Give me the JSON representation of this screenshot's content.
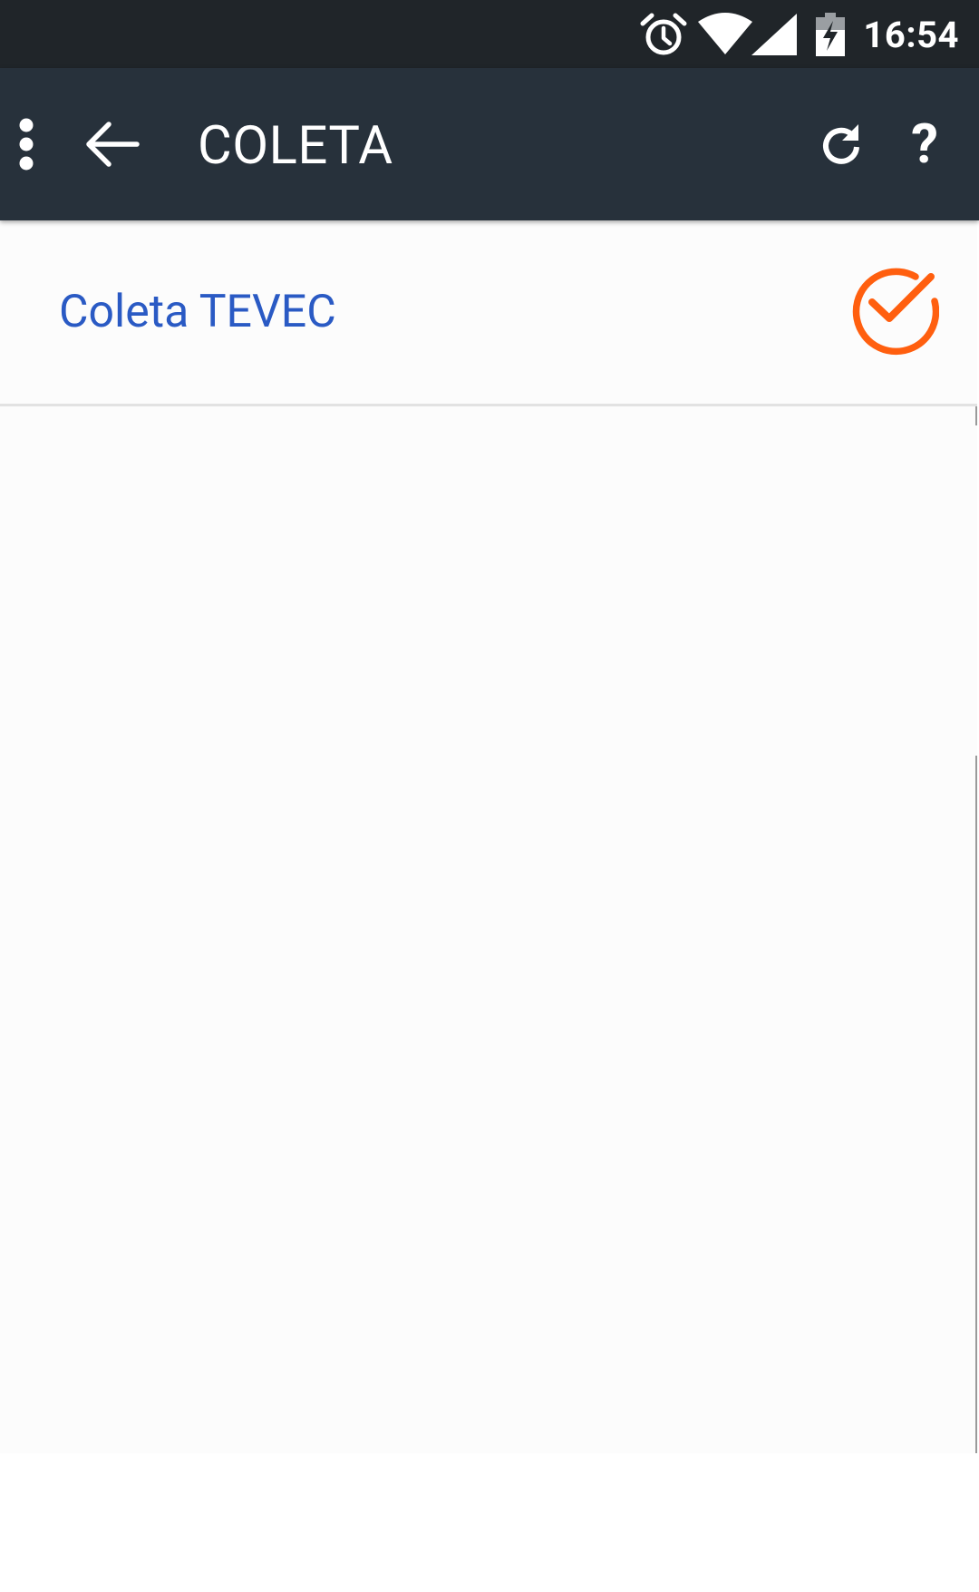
{
  "status_bar": {
    "time": "16:54",
    "icons": [
      "alarm-icon",
      "wifi-icon",
      "cell-signal-icon",
      "battery-charging-icon"
    ]
  },
  "app_bar": {
    "title": "COLETA",
    "icons": {
      "menu": "overflow-menu-icon",
      "back": "back-arrow-icon",
      "refresh": "refresh-icon",
      "help": "help-icon"
    },
    "help_glyph": "?"
  },
  "list": {
    "items": [
      {
        "label": "Coleta TEVEC",
        "status_icon": "check-circle-icon"
      }
    ]
  },
  "colors": {
    "status_bar_bg": "#202529",
    "app_bar_bg": "#27313b",
    "item_text": "#2a5ac4",
    "check_accent": "#ff5f0f",
    "content_bg": "#fcfcfc"
  }
}
